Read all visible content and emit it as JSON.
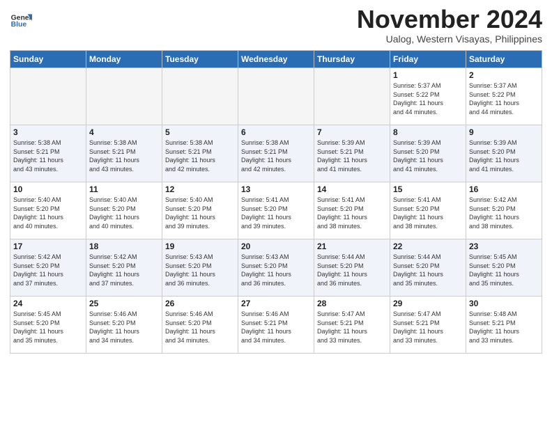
{
  "header": {
    "logo_line1": "General",
    "logo_line2": "Blue",
    "month": "November 2024",
    "location": "Ualog, Western Visayas, Philippines"
  },
  "weekdays": [
    "Sunday",
    "Monday",
    "Tuesday",
    "Wednesday",
    "Thursday",
    "Friday",
    "Saturday"
  ],
  "weeks": [
    [
      {
        "day": "",
        "info": ""
      },
      {
        "day": "",
        "info": ""
      },
      {
        "day": "",
        "info": ""
      },
      {
        "day": "",
        "info": ""
      },
      {
        "day": "",
        "info": ""
      },
      {
        "day": "1",
        "info": "Sunrise: 5:37 AM\nSunset: 5:22 PM\nDaylight: 11 hours\nand 44 minutes."
      },
      {
        "day": "2",
        "info": "Sunrise: 5:37 AM\nSunset: 5:22 PM\nDaylight: 11 hours\nand 44 minutes."
      }
    ],
    [
      {
        "day": "3",
        "info": "Sunrise: 5:38 AM\nSunset: 5:21 PM\nDaylight: 11 hours\nand 43 minutes."
      },
      {
        "day": "4",
        "info": "Sunrise: 5:38 AM\nSunset: 5:21 PM\nDaylight: 11 hours\nand 43 minutes."
      },
      {
        "day": "5",
        "info": "Sunrise: 5:38 AM\nSunset: 5:21 PM\nDaylight: 11 hours\nand 42 minutes."
      },
      {
        "day": "6",
        "info": "Sunrise: 5:38 AM\nSunset: 5:21 PM\nDaylight: 11 hours\nand 42 minutes."
      },
      {
        "day": "7",
        "info": "Sunrise: 5:39 AM\nSunset: 5:21 PM\nDaylight: 11 hours\nand 41 minutes."
      },
      {
        "day": "8",
        "info": "Sunrise: 5:39 AM\nSunset: 5:20 PM\nDaylight: 11 hours\nand 41 minutes."
      },
      {
        "day": "9",
        "info": "Sunrise: 5:39 AM\nSunset: 5:20 PM\nDaylight: 11 hours\nand 41 minutes."
      }
    ],
    [
      {
        "day": "10",
        "info": "Sunrise: 5:40 AM\nSunset: 5:20 PM\nDaylight: 11 hours\nand 40 minutes."
      },
      {
        "day": "11",
        "info": "Sunrise: 5:40 AM\nSunset: 5:20 PM\nDaylight: 11 hours\nand 40 minutes."
      },
      {
        "day": "12",
        "info": "Sunrise: 5:40 AM\nSunset: 5:20 PM\nDaylight: 11 hours\nand 39 minutes."
      },
      {
        "day": "13",
        "info": "Sunrise: 5:41 AM\nSunset: 5:20 PM\nDaylight: 11 hours\nand 39 minutes."
      },
      {
        "day": "14",
        "info": "Sunrise: 5:41 AM\nSunset: 5:20 PM\nDaylight: 11 hours\nand 38 minutes."
      },
      {
        "day": "15",
        "info": "Sunrise: 5:41 AM\nSunset: 5:20 PM\nDaylight: 11 hours\nand 38 minutes."
      },
      {
        "day": "16",
        "info": "Sunrise: 5:42 AM\nSunset: 5:20 PM\nDaylight: 11 hours\nand 38 minutes."
      }
    ],
    [
      {
        "day": "17",
        "info": "Sunrise: 5:42 AM\nSunset: 5:20 PM\nDaylight: 11 hours\nand 37 minutes."
      },
      {
        "day": "18",
        "info": "Sunrise: 5:42 AM\nSunset: 5:20 PM\nDaylight: 11 hours\nand 37 minutes."
      },
      {
        "day": "19",
        "info": "Sunrise: 5:43 AM\nSunset: 5:20 PM\nDaylight: 11 hours\nand 36 minutes."
      },
      {
        "day": "20",
        "info": "Sunrise: 5:43 AM\nSunset: 5:20 PM\nDaylight: 11 hours\nand 36 minutes."
      },
      {
        "day": "21",
        "info": "Sunrise: 5:44 AM\nSunset: 5:20 PM\nDaylight: 11 hours\nand 36 minutes."
      },
      {
        "day": "22",
        "info": "Sunrise: 5:44 AM\nSunset: 5:20 PM\nDaylight: 11 hours\nand 35 minutes."
      },
      {
        "day": "23",
        "info": "Sunrise: 5:45 AM\nSunset: 5:20 PM\nDaylight: 11 hours\nand 35 minutes."
      }
    ],
    [
      {
        "day": "24",
        "info": "Sunrise: 5:45 AM\nSunset: 5:20 PM\nDaylight: 11 hours\nand 35 minutes."
      },
      {
        "day": "25",
        "info": "Sunrise: 5:46 AM\nSunset: 5:20 PM\nDaylight: 11 hours\nand 34 minutes."
      },
      {
        "day": "26",
        "info": "Sunrise: 5:46 AM\nSunset: 5:20 PM\nDaylight: 11 hours\nand 34 minutes."
      },
      {
        "day": "27",
        "info": "Sunrise: 5:46 AM\nSunset: 5:21 PM\nDaylight: 11 hours\nand 34 minutes."
      },
      {
        "day": "28",
        "info": "Sunrise: 5:47 AM\nSunset: 5:21 PM\nDaylight: 11 hours\nand 33 minutes."
      },
      {
        "day": "29",
        "info": "Sunrise: 5:47 AM\nSunset: 5:21 PM\nDaylight: 11 hours\nand 33 minutes."
      },
      {
        "day": "30",
        "info": "Sunrise: 5:48 AM\nSunset: 5:21 PM\nDaylight: 11 hours\nand 33 minutes."
      }
    ]
  ]
}
